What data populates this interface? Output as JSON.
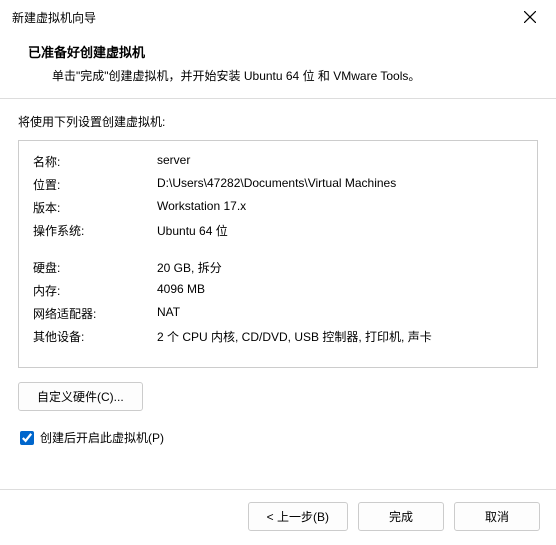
{
  "window": {
    "title": "新建虚拟机向导"
  },
  "header": {
    "title": "已准备好创建虚拟机",
    "subtitle": "单击\"完成\"创建虚拟机，并开始安装 Ubuntu 64 位 和 VMware Tools。"
  },
  "lead": "将使用下列设置创建虚拟机:",
  "rows": {
    "name_k": "名称:",
    "name_v": "server",
    "loc_k": "位置:",
    "loc_v": "D:\\Users\\47282\\Documents\\Virtual Machines",
    "ver_k": "版本:",
    "ver_v": "Workstation 17.x",
    "os_k": "操作系统:",
    "os_v": "Ubuntu 64 位",
    "disk_k": "硬盘:",
    "disk_v": "20 GB, 拆分",
    "mem_k": "内存:",
    "mem_v": "4096 MB",
    "net_k": "网络适配器:",
    "net_v": "NAT",
    "oth_k": "其他设备:",
    "oth_v": "2 个 CPU 内核, CD/DVD, USB 控制器, 打印机, 声卡"
  },
  "buttons": {
    "customize": "自定义硬件(C)...",
    "back": "< 上一步(B)",
    "finish": "完成",
    "cancel": "取消"
  },
  "checkbox": {
    "label": "创建后开启此虚拟机(P)",
    "checked": true
  }
}
